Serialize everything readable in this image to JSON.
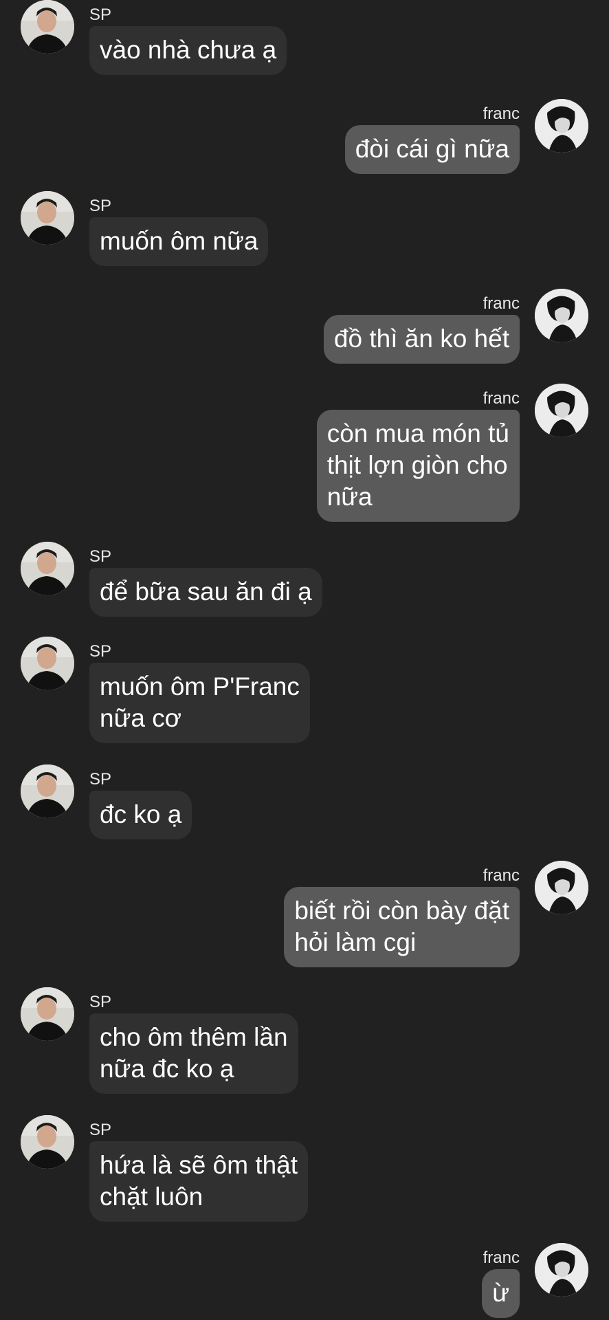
{
  "conversation": {
    "messages": [
      {
        "sender": "SP",
        "direction": "in",
        "text": "vào nhà chưa ạ"
      },
      {
        "sender": "franc",
        "direction": "out",
        "text": "đòi cái gì nữa"
      },
      {
        "sender": "SP",
        "direction": "in",
        "text": "muốn ôm nữa"
      },
      {
        "sender": "franc",
        "direction": "out",
        "text": "đồ thì ăn ko hết"
      },
      {
        "sender": "franc",
        "direction": "out",
        "text": "còn mua món tủ\nthịt lợn giòn cho\nnữa"
      },
      {
        "sender": "SP",
        "direction": "in",
        "text": "để bữa sau ăn đi ạ"
      },
      {
        "sender": "SP",
        "direction": "in",
        "text": "muốn ôm P'Franc\nnữa cơ"
      },
      {
        "sender": "SP",
        "direction": "in",
        "text": "đc ko ạ"
      },
      {
        "sender": "franc",
        "direction": "out",
        "text": "biết rồi còn bày đặt\nhỏi làm cgi"
      },
      {
        "sender": "SP",
        "direction": "in",
        "text": "cho ôm thêm lần\nnữa đc ko ạ"
      },
      {
        "sender": "SP",
        "direction": "in",
        "text": "hứa là sẽ ôm thật\nchặt luôn"
      },
      {
        "sender": "franc",
        "direction": "out",
        "text": "ừ"
      }
    ]
  },
  "icons": {
    "sp_avatar": "sp-avatar-photo",
    "franc_avatar": "franc-avatar-photo"
  },
  "colors": {
    "background": "#212121",
    "incoming_bubble": "#303030",
    "outgoing_bubble": "#5a5a5a",
    "text": "#ffffff"
  }
}
